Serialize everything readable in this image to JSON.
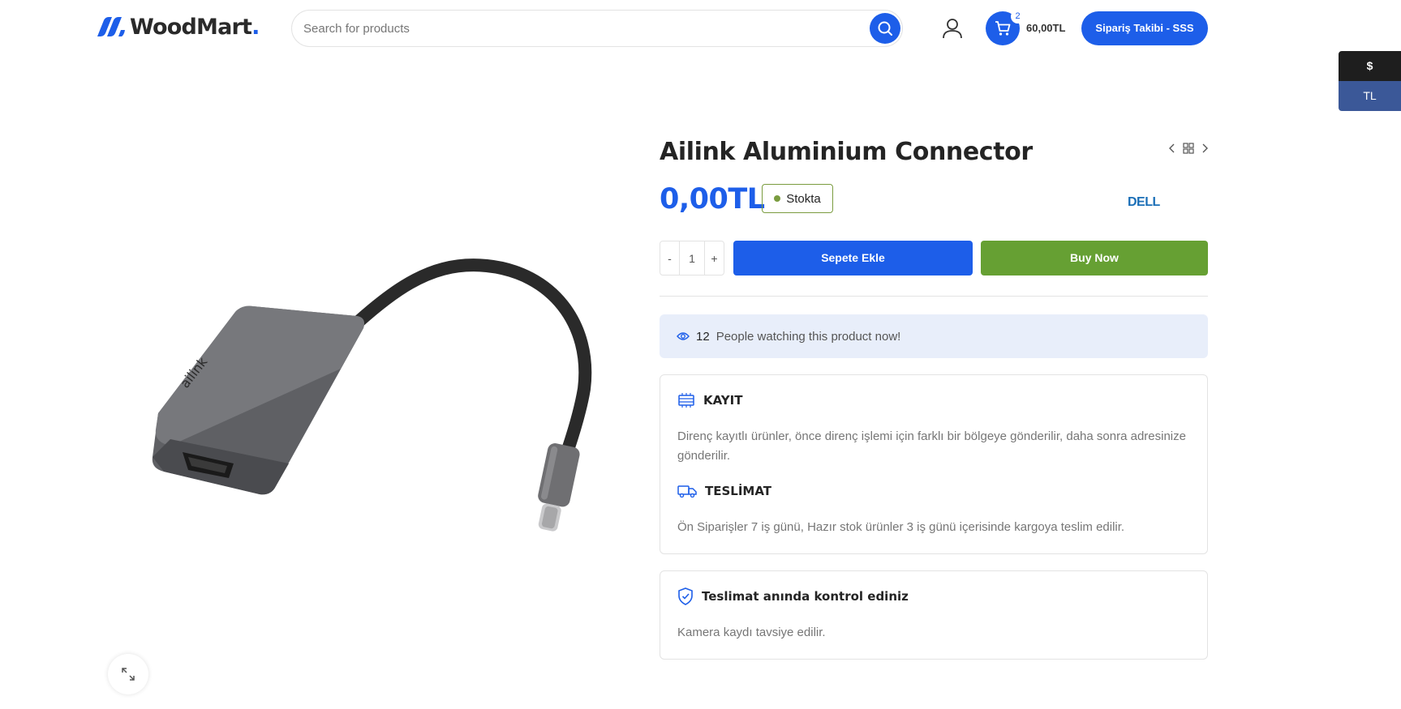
{
  "header": {
    "logo_text": "WoodMart",
    "logo_dot": ".",
    "search_placeholder": "Search for products",
    "cart_count": "2",
    "cart_total": "60,00TL",
    "track_button": "Sipariş Takibi - SSS"
  },
  "currency": {
    "options": [
      "$",
      "TL"
    ],
    "selected": "TL"
  },
  "product": {
    "title": "Ailink Aluminium Connector",
    "price": "0,00TL",
    "stock_status": "Stokta",
    "brand": "DELL",
    "quantity": "1",
    "qty_minus": "-",
    "qty_plus": "+",
    "add_to_cart": "Sepete Ekle",
    "buy_now": "Buy Now",
    "image_brand": "ailink"
  },
  "watching": {
    "count": "12",
    "text": "People watching this product now!"
  },
  "info": {
    "kayit_title": "KAYIT",
    "kayit_text": "Direnç kayıtlı ürünler, önce direnç işlemi için farklı bir bölgeye gönderilir, daha sonra adresinize gönderilir.",
    "teslimat_title": "TESLİMAT",
    "teslimat_text": "Ön Siparişler 7 iş günü, Hazır stok ürünler 3 iş günü içerisinde kargoya teslim edilir.",
    "kontrol_title": "Teslimat anında kontrol ediniz",
    "kontrol_text": "Kamera kaydı tavsiye edilir."
  },
  "colors": {
    "primary": "#1d5ee9",
    "buy_now": "#66a033",
    "stock": "#7a9c3f",
    "currency_dark": "#1e1e1e",
    "currency_selected": "#3b5898"
  },
  "icons": [
    "logo-icon",
    "search-icon",
    "user-icon",
    "cart-icon",
    "chevron-left-icon",
    "grid-icon",
    "chevron-right-icon",
    "eye-icon",
    "registration-icon",
    "truck-icon",
    "shield-check-icon",
    "expand-icon"
  ]
}
